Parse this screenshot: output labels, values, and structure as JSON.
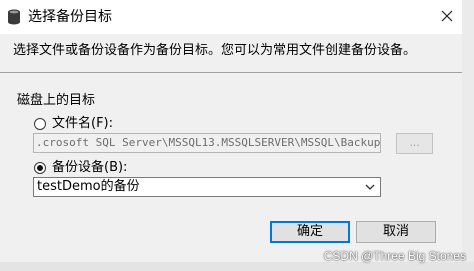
{
  "window": {
    "title": "选择备份目标",
    "title_icon": "database-icon",
    "close_icon": "close-icon"
  },
  "description": "选择文件或备份设备作为备份目标。您可以为常用文件创建备份设备。",
  "destination": {
    "group_label": "磁盘上的目标",
    "file_option_label": "文件名(F):",
    "file_path_value": ".crosoft SQL Server\\MSSQL13.MSSQLSERVER\\MSSQL\\Backup\\",
    "browse_label": "...",
    "file_selected": false,
    "device_option_label": "备份设备(B):",
    "device_selected": true,
    "device_value": "testDemo的备份"
  },
  "buttons": {
    "ok_label": "确定",
    "cancel_label": "取消"
  },
  "watermark": "CSDN @Three Big Stones"
}
